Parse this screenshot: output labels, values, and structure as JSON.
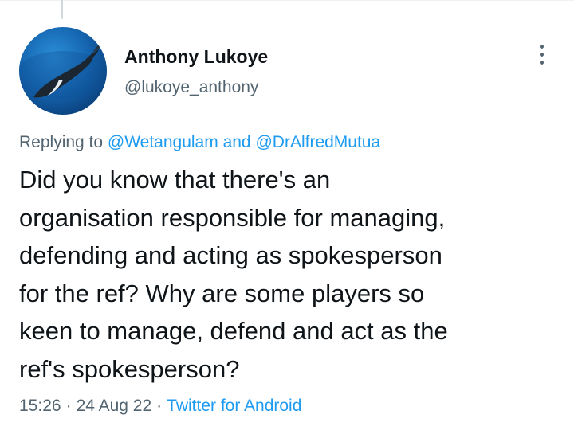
{
  "author": {
    "display_name": "Anthony Lukoye",
    "handle": "@lukoye_anthony"
  },
  "reply": {
    "prefix": "Replying to",
    "mentions": [
      "@Wetangulam",
      "@DrAlfredMutua"
    ],
    "conjunction": "and"
  },
  "tweet": {
    "lines": [
      "Did you know that there's an",
      "organisation responsible for managing,",
      "defending and acting as spokesperson",
      "for the ref? Why are some players so",
      "keen to manage, defend and act as the",
      "ref's spokesperson?"
    ]
  },
  "meta": {
    "time": "15:26",
    "date": "24 Aug 22",
    "separator": "·",
    "source": "Twitter for Android"
  },
  "icons": {
    "more": "more-options-icon",
    "avatar": "whale-avatar"
  },
  "colors": {
    "text": "#0f1419",
    "secondary": "#536471",
    "link": "#1d9bf0",
    "background": "#ffffff"
  }
}
